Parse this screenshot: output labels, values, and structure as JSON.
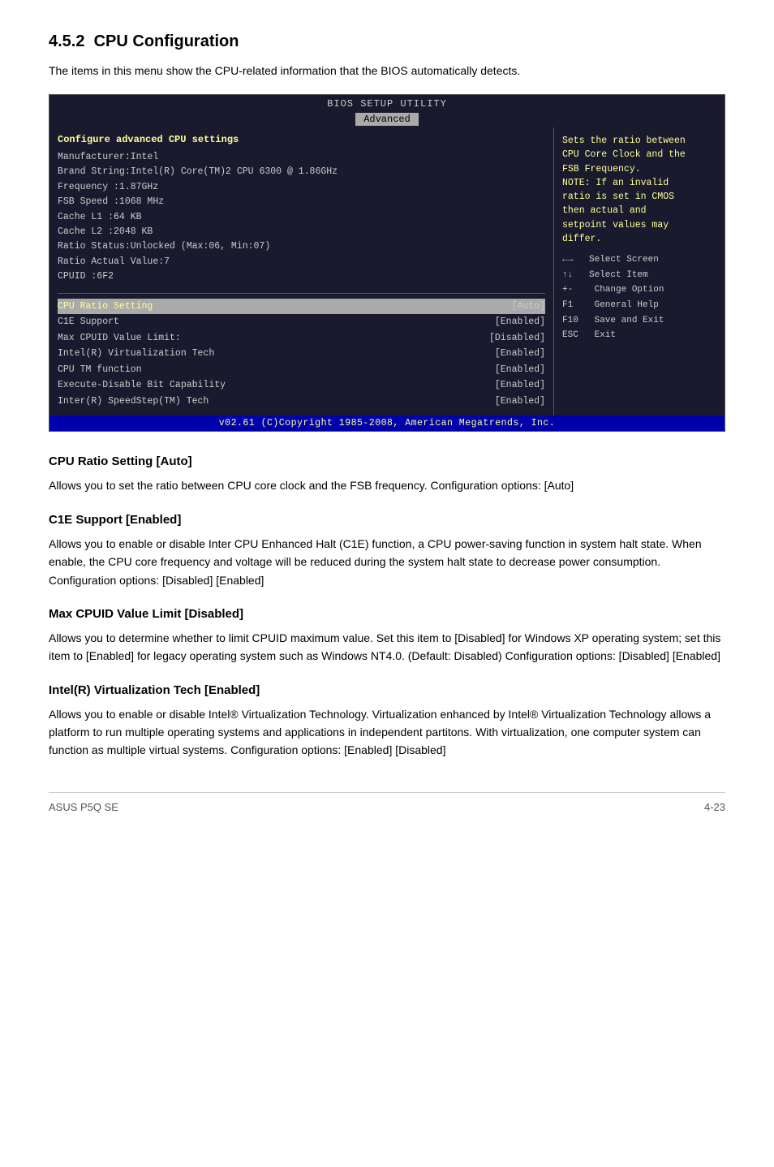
{
  "section": {
    "number": "4.5.2",
    "title": "CPU Configuration",
    "intro": "The items in this menu show the CPU-related information that the BIOS automatically detects."
  },
  "bios": {
    "title": "BIOS SETUP UTILITY",
    "tab": "Advanced",
    "left_header": "Configure advanced CPU settings",
    "info_lines": [
      "Manufacturer:Intel",
      "Brand String:Intel(R) Core(TM)2 CPU 6300 @ 1.86GHz",
      "Frequency    :1.87GHz",
      "FSB Speed    :1068 MHz",
      "Cache L1     :64 KB",
      "Cache L2     :2048 KB",
      "Ratio Status:Unlocked (Max:06, Min:07)",
      "Ratio Actual Value:7",
      "CPUID        :6F2"
    ],
    "menu_items": [
      {
        "label": "CPU Ratio Setting",
        "value": "[Auto]",
        "highlighted": true
      },
      {
        "label": "C1E Support",
        "value": "[Enabled]",
        "highlighted": false
      },
      {
        "label": "Max CPUID Value Limit:",
        "value": "[Disabled]",
        "highlighted": false
      },
      {
        "label": "Intel(R) Virtualization Tech",
        "value": "[Enabled]",
        "highlighted": false
      },
      {
        "label": "CPU TM function",
        "value": "[Enabled]",
        "highlighted": false
      },
      {
        "label": "Execute-Disable Bit Capability",
        "value": "[Enabled]",
        "highlighted": false
      },
      {
        "label": "Inter(R) SpeedStep(TM) Tech",
        "value": "[Enabled]",
        "highlighted": false
      }
    ],
    "right_help": [
      "Sets the ratio between",
      "CPU Core Clock and the",
      "FSB Frequency.",
      "NOTE: If an invalid",
      "ratio is set in CMOS",
      "then actual and",
      "setpoint values may",
      "differ."
    ],
    "keys": [
      {
        "key": "←→",
        "action": "Select Screen"
      },
      {
        "key": "↑↓",
        "action": "Select Item"
      },
      {
        "key": "+-",
        "action": "Change Option"
      },
      {
        "key": "F1",
        "action": "General Help"
      },
      {
        "key": "F10",
        "action": "Save and Exit"
      },
      {
        "key": "ESC",
        "action": "Exit"
      }
    ],
    "footer": "v02.61 (C)Copyright 1985-2008, American Megatrends, Inc."
  },
  "subsections": [
    {
      "id": "cpu-ratio",
      "title": "CPU Ratio Setting [Auto]",
      "text": "Allows you to set the ratio between CPU core clock and the FSB frequency. Configuration options: [Auto]"
    },
    {
      "id": "c1e-support",
      "title": "C1E Support [Enabled]",
      "text": "Allows you to enable or disable Inter CPU Enhanced Halt (C1E) function, a CPU power-saving function in system halt state. When enable, the CPU core frequency and voltage will be reduced during the system halt state to decrease power consumption. Configuration options: [Disabled] [Enabled]"
    },
    {
      "id": "max-cpuid",
      "title": "Max CPUID Value Limit [Disabled]",
      "text": "Allows you to determine whether to limit CPUID maximum value. Set this item to [Disabled] for Windows XP operating system; set this item to [Enabled] for legacy operating system such as Windows NT4.0. (Default: Disabled) Configuration options: [Disabled] [Enabled]"
    },
    {
      "id": "vt",
      "title": "Intel(R) Virtualization Tech [Enabled]",
      "text": "Allows you to enable or disable Intel® Virtualization Technology. Virtualization enhanced by Intel® Virtualization Technology allows a platform to run multiple operating systems and applications in independent partitons. With virtualization, one computer system can function as multiple virtual systems. Configuration options: [Enabled] [Disabled]"
    }
  ],
  "footer": {
    "left": "ASUS P5Q SE",
    "right": "4-23"
  }
}
